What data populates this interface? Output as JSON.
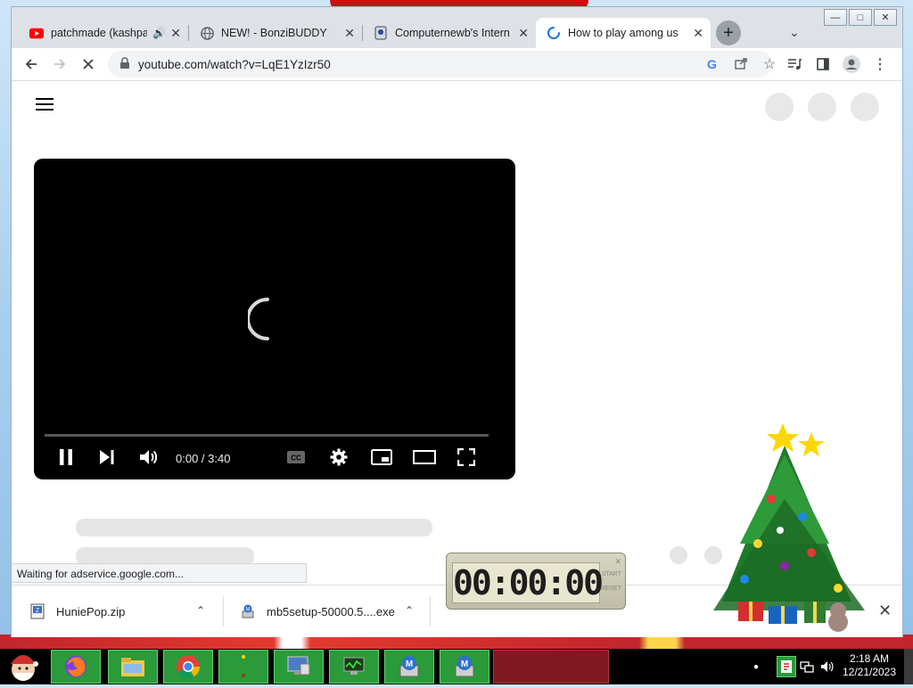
{
  "browser": {
    "tabs": [
      {
        "title": "patchmade (kashpa",
        "active": false
      },
      {
        "title": "NEW! - BonziBUDDY!",
        "active": false
      },
      {
        "title": "Computernewb's Interne",
        "active": false
      },
      {
        "title": "How to play among us f",
        "active": true
      }
    ],
    "url": "youtube.com/watch?v=LqE1YzIzr50"
  },
  "player": {
    "time": "0:00 / 3:40",
    "progress_fraction": 0.0
  },
  "status_text": "Waiting for adservice.google.com...",
  "downloads": [
    {
      "name": "HuniePop.zip"
    },
    {
      "name": "mb5setup-50000.5....exe"
    }
  ],
  "timer": {
    "display": "00:00:00",
    "start_label": "START",
    "reset_label": "RESET"
  },
  "clock": {
    "time": "2:18 AM",
    "date": "12/21/2023"
  },
  "colors": {
    "taskbar_button": "#2a9a3a",
    "youtube_red": "#ff0000",
    "loading_blue": "#1a73e8"
  }
}
